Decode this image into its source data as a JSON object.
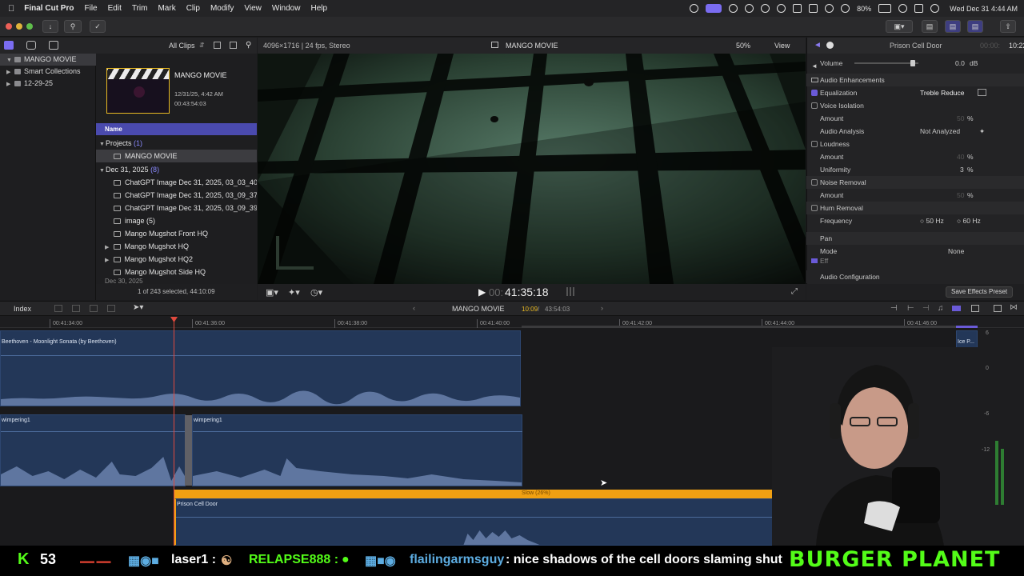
{
  "menubar": {
    "apple": "",
    "app": "Final Cut Pro",
    "items": [
      "File",
      "Edit",
      "Trim",
      "Mark",
      "Clip",
      "Modify",
      "View",
      "Window",
      "Help"
    ],
    "battery": "80%",
    "datetime": "Wed Dec 31  4:44 AM"
  },
  "browser": {
    "filter": "All Clips",
    "library": "MANGO MOVIE",
    "collections": [
      "Smart Collections",
      "12-29-25"
    ],
    "project": {
      "title": "MANGO MOVIE",
      "date": "12/31/25, 4:42 AM",
      "duration": "00:43:54:03"
    },
    "column": "Name",
    "projects_label": "Projects",
    "projects_count": "(1)",
    "project_item": "MANGO MOVIE",
    "event_label": "Dec 31, 2025",
    "event_count": "(8)",
    "items": [
      "ChatGPT Image Dec 31, 2025, 03_03_40",
      "ChatGPT Image Dec 31, 2025, 03_09_37",
      "ChatGPT Image Dec 31, 2025, 03_09_39",
      "image (5)",
      "Mango Mugshot Front HQ",
      "Mango Mugshot HQ",
      "Mango Mugshot HQ2",
      "Mango Mugshot Side HQ"
    ],
    "next_event": "Dec 30, 2025",
    "selection": "1 of 243 selected, 44:10:09"
  },
  "viewer": {
    "format": "4096×1716 | 24 fps, Stereo",
    "title": "MANGO MOVIE",
    "zoom": "50%",
    "view_label": "View",
    "timecode": "41:35:18",
    "timecode_dim": "00:"
  },
  "inspector": {
    "clip": "Prison Cell Door",
    "time_dim": "00:00:",
    "time": "10:22",
    "volume_label": "Volume",
    "volume": "0.0",
    "db": "dB",
    "enh_label": "Audio Enhancements",
    "eq_label": "Equalization",
    "eq_value": "Treble Reduce",
    "voice_label": "Voice Isolation",
    "amount_label": "Amount",
    "voice_amount": "50",
    "pct": "%",
    "analysis_label": "Audio Analysis",
    "analysis_value": "Not Analyzed",
    "loud_label": "Loudness",
    "loud_amount": "40",
    "uniform_label": "Uniformity",
    "uniformity": "3",
    "noise_label": "Noise Removal",
    "noise_amount": "50",
    "hum_label": "Hum Removal",
    "freq_label": "Frequency",
    "freq1": "50",
    "freq2": "60",
    "hz": "Hz",
    "pan_label": "Pan",
    "mode_label": "Mode",
    "mode_value": "None",
    "effects_label": "Eff",
    "config": "Audio Configuration",
    "save_preset": "Save Effects Preset"
  },
  "timeline": {
    "index": "Index",
    "project": "MANGO MOVIE",
    "pos": "10:09",
    "total": "43:54:03",
    "sep": " / ",
    "ruler": [
      "00:41:34:00",
      "00:41:36:00",
      "00:41:38:00",
      "00:41:40:00",
      "00:41:42:00",
      "00:41:44:00",
      "00:41:46:00"
    ],
    "clip_music": "Beethoven - Moonlight Sonata (by Beethoven)",
    "clip_right": "Ice P...",
    "clip_whimper1": "wimpering1",
    "clip_whimper2": "wimpering1",
    "retime": "Slow (26%)",
    "clip_door": "Prison Cell Door",
    "meter_labels": [
      "6",
      "0",
      "-6",
      "-12"
    ]
  },
  "ticker": {
    "k_count": "53",
    "user1": "laser1 :",
    "user2": "RELAPSE888 :",
    "user3": "flailingarmsguy",
    "msg3": ": nice shadows of the cell doors slaming shut",
    "brand": "BURGER PLANET"
  },
  "colors": {
    "accent": "#6a5ad8",
    "selection": "#4a4aae",
    "playhead": "#e0493d",
    "clip_blue": "#233758",
    "retime_orange": "#f0a012",
    "kick_green": "#53fc18"
  }
}
